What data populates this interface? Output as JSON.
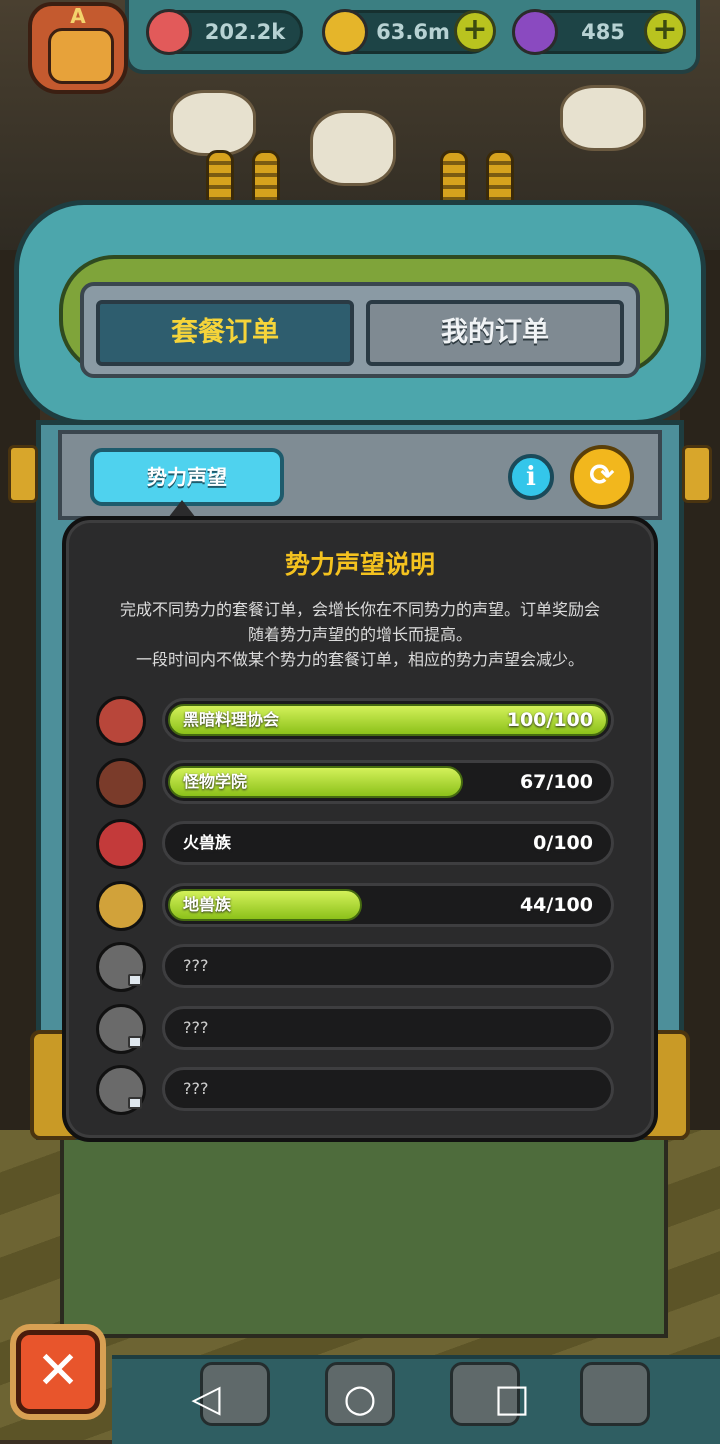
{
  "currency": {
    "eye": "202.2k",
    "coin": "63.6m",
    "potion": "485",
    "plus_symbol": "+"
  },
  "avatar_letter": "A",
  "tabs": {
    "set_orders": "套餐订单",
    "my_orders": "我的订单"
  },
  "reputation_tab": "势力声望",
  "info_symbol": "i",
  "refresh_symbol": "⟳",
  "popup": {
    "title": "势力声望说明",
    "desc_line1": "完成不同势力的套餐订单，会增长你在不同势力的声望。订单奖励会",
    "desc_line2": "随着势力声望的的增长而提高。",
    "desc_line3": "一段时间内不做某个势力的套餐订单，相应的势力声望会减少。"
  },
  "factions": [
    {
      "name": "黑暗料理协会",
      "value": "100/100",
      "progress": 1.0,
      "color": "#b8463a"
    },
    {
      "name": "怪物学院",
      "value": "67/100",
      "progress": 0.67,
      "color": "#7a3b2a"
    },
    {
      "name": "火兽族",
      "value": "0/100",
      "progress": 0.0,
      "color": "#c33a3a"
    },
    {
      "name": "地兽族",
      "value": "44/100",
      "progress": 0.44,
      "color": "#d1a23a"
    },
    {
      "name": "???",
      "value": "",
      "progress": 0.0,
      "color": "#6a6a6a"
    },
    {
      "name": "???",
      "value": "",
      "progress": 0.0,
      "color": "#6a6a6a"
    },
    {
      "name": "???",
      "value": "",
      "progress": 0.0,
      "color": "#6a6a6a"
    }
  ],
  "close_symbol": "✕",
  "nav": {
    "back": "◁",
    "home": "○",
    "recent": "□"
  },
  "colors": {
    "accent_yellow": "#f4c21f",
    "bar_green": "#a6d62a",
    "tab_cyan": "#4fd2ee"
  }
}
